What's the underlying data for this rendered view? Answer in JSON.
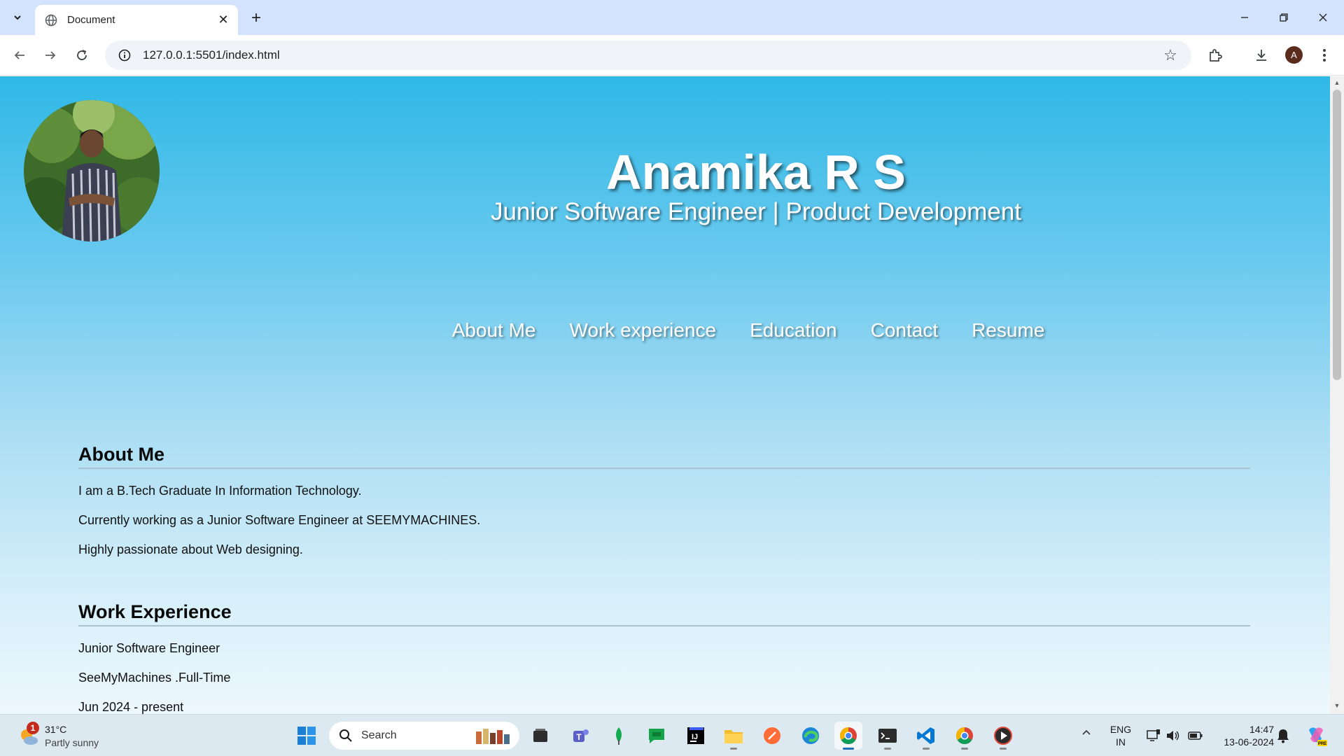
{
  "browser": {
    "tab_title": "Document",
    "url": "127.0.0.1:5501/index.html",
    "profile_initial": "A"
  },
  "hero": {
    "name": "Anamika R S",
    "subtitle": "Junior Software Engineer | Product Development"
  },
  "nav": {
    "items": [
      "About Me",
      "Work experience",
      "Education",
      "Contact",
      "Resume"
    ]
  },
  "about": {
    "heading": "About Me",
    "lines": [
      "I am a B.Tech Graduate In Information Technology.",
      "Currently working as a Junior Software Engineer at SEEMYMACHINES.",
      "Highly passionate about Web designing."
    ]
  },
  "work": {
    "heading": "Work Experience",
    "lines": [
      "Junior Software Engineer",
      "SeeMyMachines .Full-Time",
      "Jun 2024 - present"
    ]
  },
  "taskbar": {
    "weather_badge": "1",
    "weather_temp": "31°C",
    "weather_desc": "Partly sunny",
    "search_label": "Search",
    "lang_line1": "ENG",
    "lang_line2": "IN",
    "time": "14:47",
    "date": "13-06-2024"
  },
  "colors": {
    "gradient_top": "#2fb8e6",
    "gradient_bottom": "#edf8fd",
    "tabstrip": "#d3e3fd",
    "taskbar": "#dde9f0"
  }
}
